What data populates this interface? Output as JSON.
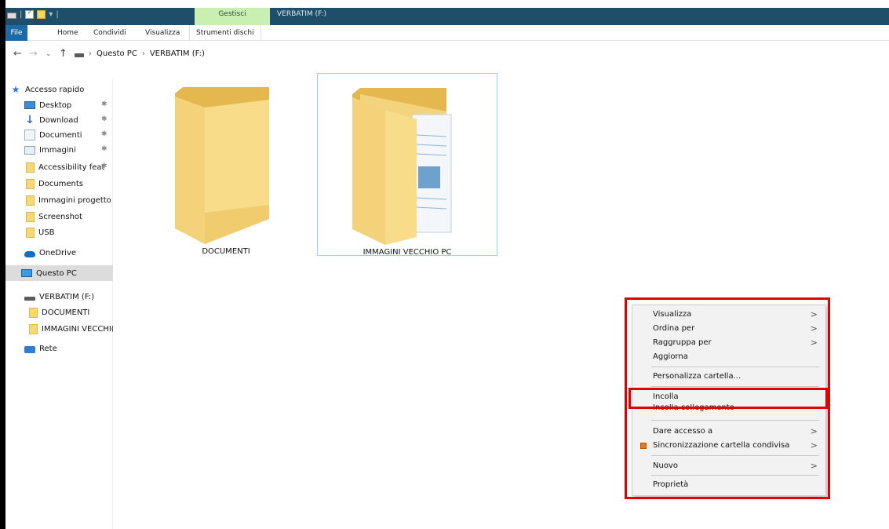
{
  "window": {
    "title": "VERBATIM (F:)",
    "contextual_tab_group": "Gestisci"
  },
  "ribbon": {
    "tabs": [
      "File",
      "Home",
      "Condividi",
      "Visualizza",
      "Strumenti dischi"
    ]
  },
  "address": {
    "crumbs": [
      "Questo PC",
      "VERBATIM (F:)"
    ],
    "separator": "›"
  },
  "sidebar": {
    "quick_access": "Accesso rapido",
    "items": [
      {
        "label": "Desktop",
        "icon": "desktop-icon",
        "pinned": true
      },
      {
        "label": "Download",
        "icon": "download-icon",
        "pinned": true
      },
      {
        "label": "Documenti",
        "icon": "documents-icon",
        "pinned": true
      },
      {
        "label": "Immagini",
        "icon": "pictures-icon",
        "pinned": true
      },
      {
        "label": "Accessibility feat",
        "icon": "folder-icon",
        "pinned": true
      },
      {
        "label": "Documents",
        "icon": "folder-icon",
        "pinned": false
      },
      {
        "label": "Immagini progetto",
        "icon": "folder-icon",
        "pinned": false
      },
      {
        "label": "Screenshot",
        "icon": "folder-icon",
        "pinned": false
      },
      {
        "label": "USB",
        "icon": "folder-icon",
        "pinned": false
      }
    ],
    "onedrive": "OneDrive",
    "this_pc": "Questo PC",
    "drive": "VERBATIM (F:)",
    "drive_children": [
      "DOCUMENTI",
      "IMMAGINI VECCHI("
    ],
    "network": "Rete"
  },
  "content": {
    "folders": [
      {
        "label": "DOCUMENTI",
        "selected": false
      },
      {
        "label": "IMMAGINI VECCHIO PC",
        "selected": true
      }
    ]
  },
  "context_menu": {
    "items": [
      {
        "label": "Visualizza",
        "submenu": true
      },
      {
        "label": "Ordina per",
        "submenu": true
      },
      {
        "label": "Raggruppa per",
        "submenu": true
      },
      {
        "label": "Aggiorna",
        "submenu": false
      },
      {
        "label": "Personalizza cartella...",
        "submenu": false
      },
      {
        "label": "Incolla",
        "submenu": false
      },
      {
        "label": "Incolla collegamento",
        "submenu": false
      },
      {
        "label": "Dare accesso a",
        "submenu": true
      },
      {
        "label": "Sincronizzazione cartella condivisa",
        "submenu": true
      },
      {
        "label": "Nuovo",
        "submenu": true
      },
      {
        "label": "Proprietà",
        "submenu": false
      }
    ],
    "highlight_color": "#e10000"
  }
}
